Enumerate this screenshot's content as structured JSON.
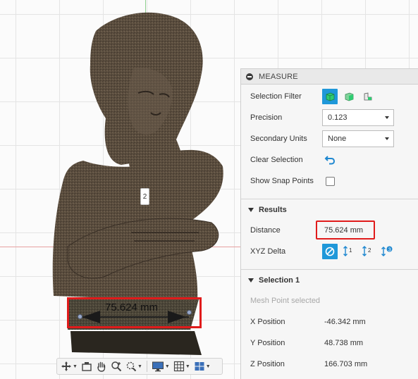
{
  "viewport": {
    "marker_label": "2",
    "dimension_label": "75.624 mm"
  },
  "panel": {
    "title": "MEASURE",
    "selection_filter_label": "Selection Filter",
    "precision_label": "Precision",
    "precision_value": "0.123",
    "secondary_units_label": "Secondary Units",
    "secondary_units_value": "None",
    "clear_selection_label": "Clear Selection",
    "show_snap_points_label": "Show Snap Points",
    "show_snap_points_checked": false,
    "results_title": "Results",
    "distance_label": "Distance",
    "distance_value": "75.624 mm",
    "xyz_delta_label": "XYZ Delta",
    "selection1_title": "Selection 1",
    "selection1_status": "Mesh Point selected",
    "x_position_label": "X Position",
    "x_position_value": "-46.342 mm",
    "y_position_label": "Y Position",
    "y_position_value": "48.738 mm",
    "z_position_label": "Z Position",
    "z_position_value": "166.703 mm"
  },
  "icons": {
    "selection_filter": [
      "body-filter-icon",
      "face-filter-icon",
      "edge-filter-icon"
    ],
    "xyz_delta": [
      "none-icon",
      "x-delta-icon",
      "y-delta-icon",
      "z-delta-icon"
    ],
    "nav_toolbar": [
      "orbit-icon",
      "look-at-icon",
      "pan-icon",
      "zoom-icon",
      "fit-icon",
      "display-settings-icon",
      "grid-icon",
      "viewports-icon"
    ]
  },
  "colors": {
    "accent": "#1f98d9",
    "highlight_red": "#e01b1b",
    "bronze": "#5a4d3e"
  }
}
